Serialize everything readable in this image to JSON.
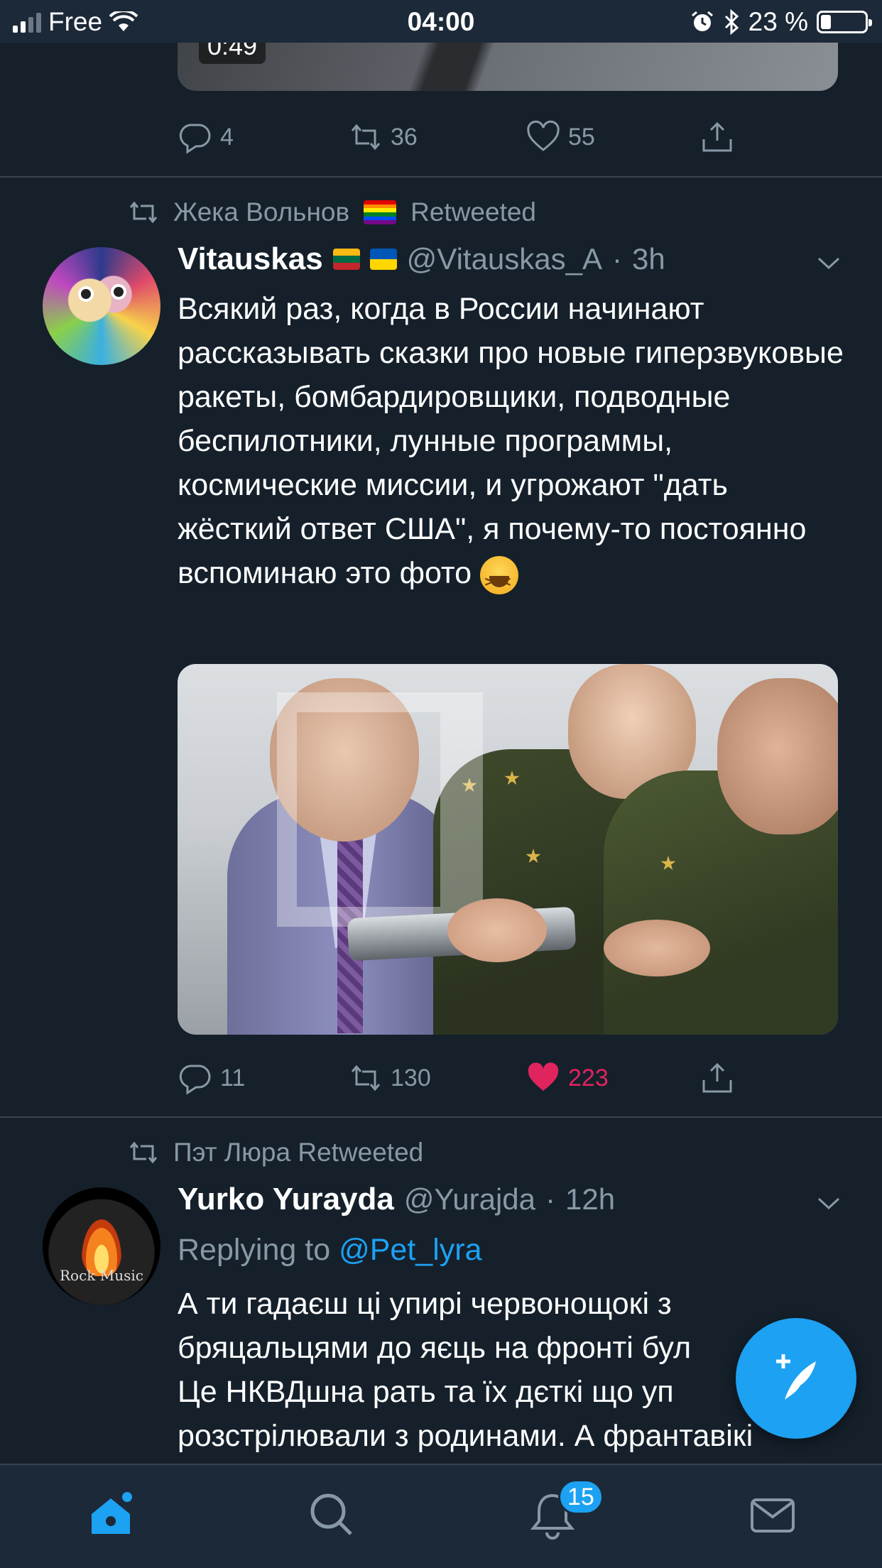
{
  "status_bar": {
    "carrier": "Free",
    "time": "04:00",
    "battery_percent": "23 %",
    "battery_level": 0.23,
    "icons": [
      "signal-icon",
      "wifi-icon",
      "alarm-icon",
      "bluetooth-icon",
      "battery-icon"
    ]
  },
  "tweets": [
    {
      "video_duration": "0:49",
      "actions": {
        "replies": "4",
        "retweets": "36",
        "likes": "55"
      }
    },
    {
      "retweeted_by": "Жека Вольнов",
      "retweeted_label": "Retweeted",
      "name": "Vitauskas",
      "handle": "@Vitauskas_A",
      "time": "3h",
      "text": "Всякий раз, когда в России начинают рассказывать сказки про новые гиперзвуковые ракеты, бомбардировщики, подводные беспилотники, лунные программы, космические миссии, и угрожают \"дать жёсткий ответ США\", я почему-то постоянно вспоминаю это фото",
      "actions": {
        "replies": "11",
        "retweets": "130",
        "likes": "223",
        "liked": true
      }
    },
    {
      "retweeted_line": "Пэт Люра Retweeted",
      "name": "Yurko Yurayda",
      "handle": "@Yurajda",
      "time": "12h",
      "replying_prefix": "Replying to",
      "replying_to": "@Pet_lyra",
      "text_lines": [
        "А ти гадаєш ці упирі червонощокі з",
        "бряцальцями до яєць на фронті бул",
        "Це НКВДшна рать та їх дєткі що уп",
        "розстрілювали з родинами. А франтавікі"
      ],
      "avatar_text": "Rock Music"
    }
  ],
  "tabbar": {
    "items": [
      "home-icon",
      "search-icon",
      "notifications-icon",
      "messages-icon"
    ],
    "notifications_badge": "15"
  },
  "colors": {
    "background": "#15202b",
    "bars": "#1c2938",
    "accent": "#1da1f2",
    "muted": "#8899a6",
    "like": "#e0245e"
  }
}
